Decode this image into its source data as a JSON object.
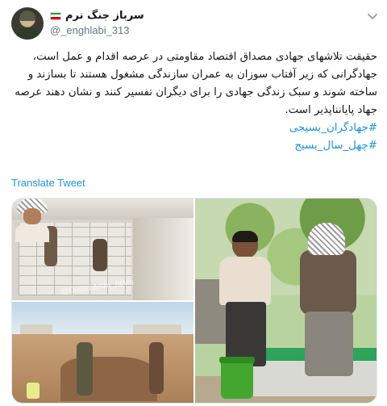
{
  "author": {
    "display_name": "سرباز جنگ نرم",
    "handle": "@_enghlabi_313",
    "flag_colors": [
      "#239f40",
      "#ffffff",
      "#da0000"
    ],
    "avatar_icon": "soldier-avatar"
  },
  "tweet": {
    "text": "حقیقت تلاشهای جهادی مصداق اقتصاد مقاومتی در عرصه اقدام و عمل است، جهادگرانی که زیر آفتاب سوزان به عمران سازندگی مشغول هستند تا بسازند و ساخته شوند و سبک زندگی جهادی را برای دیگران تفسیر کنند و نشان دهند عرصه جهاد پایانناپذیر است.",
    "hashtags": [
      "#جهادگران_بسیجی",
      "#چهل_سال_بسیج"
    ],
    "translate_label": "Translate Tweet",
    "hashtag_color": "#1b95e0"
  },
  "media": {
    "watermark": "@Daramadan_news"
  },
  "icons": {
    "menu": "chevron-down-icon"
  }
}
